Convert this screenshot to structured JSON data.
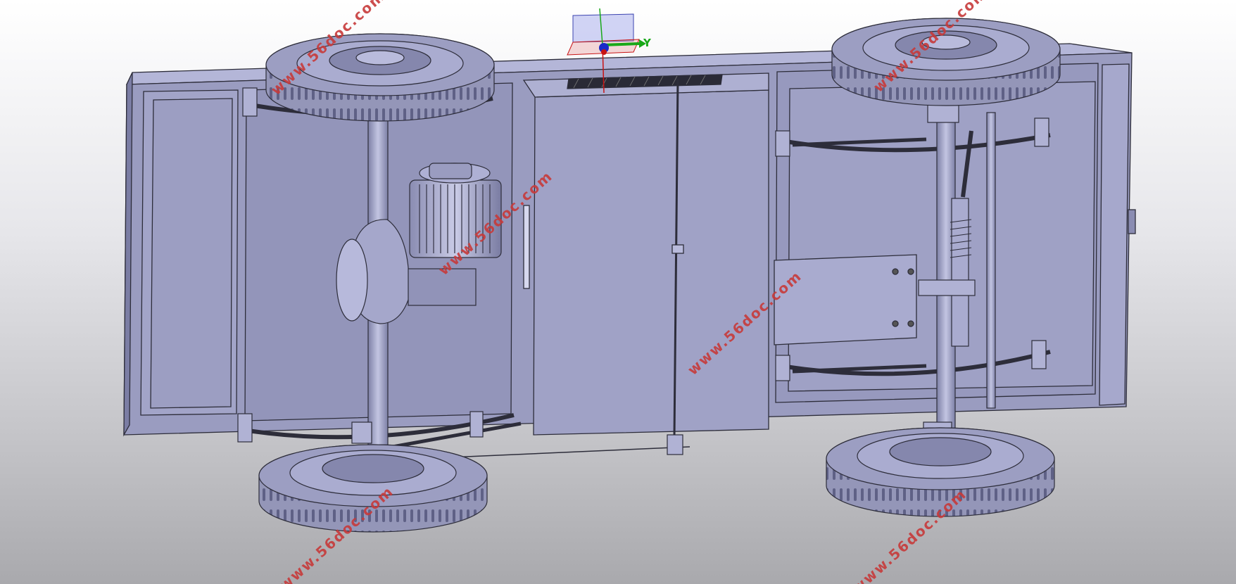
{
  "viewport": {
    "background_top": "#ffffff",
    "background_bottom": "#a9a9ad"
  },
  "model": {
    "body_color": "#9a9cc0",
    "body_light": "#b4b6d8",
    "body_dark": "#7b7da4",
    "edge_color": "#2d2d3a",
    "tire_color": "#8f91b4"
  },
  "compass": {
    "y_label": "Y",
    "y_color": "#18a818",
    "z_color": "#18a818",
    "x_color": "#c81414",
    "plane_color": "#6b74e0"
  },
  "watermark": {
    "text": "www.56doc.com",
    "color": "#c73a3a"
  }
}
